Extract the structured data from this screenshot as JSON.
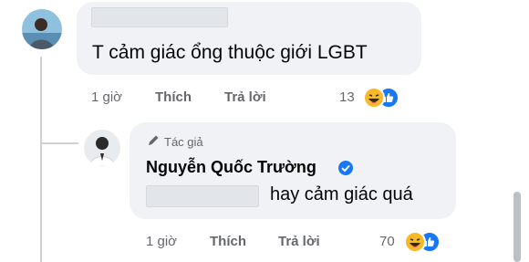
{
  "comment": {
    "text": "T cảm giác ổng thuộc giới LGBT",
    "time": "1 giờ",
    "like_label": "Thích",
    "reply_label": "Trả lời",
    "reaction_count": "13",
    "reactions": [
      "haha-emoji-icon",
      "like-emoji-icon"
    ]
  },
  "reply": {
    "author_badge": "Tác giả",
    "author_name": "Nguyễn Quốc Trường",
    "text": "hay cảm giác quá",
    "time": "1 giờ",
    "like_label": "Thích",
    "reply_label": "Trả lời",
    "reaction_count": "70",
    "reactions": [
      "haha-emoji-icon",
      "like-emoji-icon"
    ]
  },
  "colors": {
    "bubble": "#f0f2f5",
    "secondary_text": "#65676b",
    "verified_blue": "#1877f2",
    "like_blue": "#1877f2",
    "haha_yellow": "#f7b928"
  }
}
